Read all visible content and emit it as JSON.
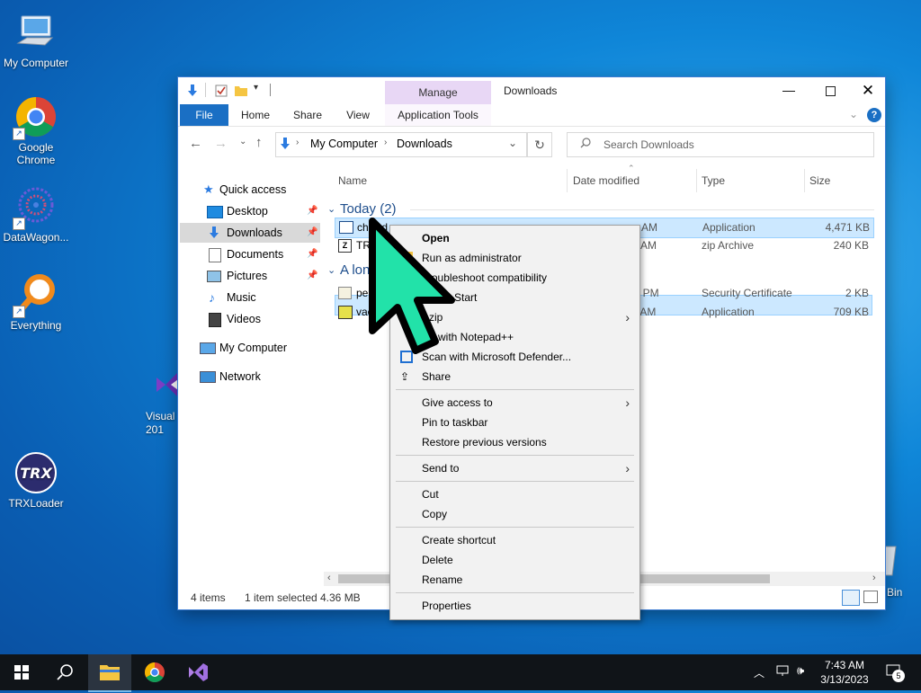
{
  "desktop": {
    "icons": [
      {
        "label": "My Computer"
      },
      {
        "label": "Google Chrome"
      },
      {
        "label": "DataWagon..."
      },
      {
        "label": "Everything"
      },
      {
        "label": "Visual S 201"
      },
      {
        "label": "TRXLoader"
      },
      {
        "label": "Bin"
      }
    ]
  },
  "explorer": {
    "title": "Downloads",
    "contextual_tab": "Manage",
    "tabs": [
      "File",
      "Home",
      "Share",
      "View",
      "Application Tools"
    ],
    "breadcrumb": [
      "My Computer",
      "Downloads"
    ],
    "search_placeholder": "Search Downloads",
    "nav": [
      {
        "label": "Quick access"
      },
      {
        "label": "Desktop"
      },
      {
        "label": "Downloads"
      },
      {
        "label": "Documents"
      },
      {
        "label": "Pictures"
      },
      {
        "label": "Music"
      },
      {
        "label": "Videos"
      },
      {
        "label": "My Computer"
      },
      {
        "label": "Network"
      }
    ],
    "columns": [
      "Name",
      "Date modified",
      "Type",
      "Size"
    ],
    "groups": [
      {
        "label": "Today (2)"
      },
      {
        "label": "A lon"
      }
    ],
    "files": [
      {
        "name": "chilled",
        "date": "AM",
        "type": "Application",
        "size": "4,471 KB"
      },
      {
        "name": "TRX",
        "date": "AM",
        "type": "zip Archive",
        "size": "240 KB"
      },
      {
        "name": "per",
        "date": "58 PM",
        "type": "Security Certificate",
        "size": "2 KB"
      },
      {
        "name": "vac",
        "date": "7 AM",
        "type": "Application",
        "size": "709 KB"
      }
    ],
    "status": {
      "items": "4 items",
      "selected": "1 item selected",
      "size": "4.36 MB"
    }
  },
  "context_menu": {
    "items": [
      {
        "label": "Open"
      },
      {
        "label": "Run as administrator"
      },
      {
        "label": "Troubleshoot compatibility"
      },
      {
        "label": "Start"
      },
      {
        "label": "zip"
      },
      {
        "label": "with Notepad++"
      },
      {
        "label": "Scan with Microsoft Defender..."
      },
      {
        "label": "Share"
      },
      {
        "label": "Give access to"
      },
      {
        "label": "Pin to taskbar"
      },
      {
        "label": "Restore previous versions"
      },
      {
        "label": "Send to"
      },
      {
        "label": "Cut"
      },
      {
        "label": "Copy"
      },
      {
        "label": "Create shortcut"
      },
      {
        "label": "Delete"
      },
      {
        "label": "Rename"
      },
      {
        "label": "Properties"
      }
    ]
  },
  "taskbar": {
    "time": "7:43 AM",
    "date": "3/13/2023",
    "notification_count": "5"
  },
  "colors": {
    "accent": "#0063b1",
    "manage_tab": "#e8d7f5",
    "selection": "#cce8ff",
    "cursor": "#20e0a8"
  }
}
